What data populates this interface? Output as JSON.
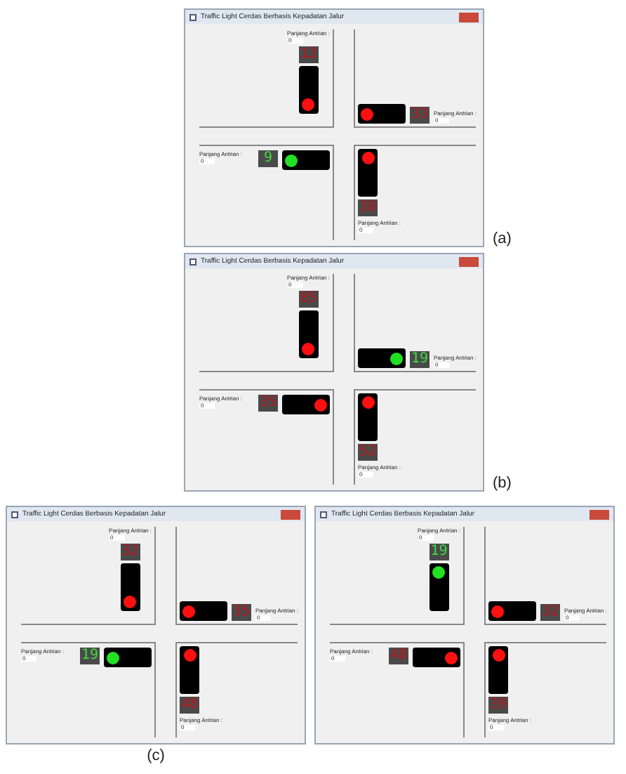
{
  "windows": [
    {
      "title": "Traffic Light Cerdas Berbasis Kepadatan Jalur",
      "caption": "(a)",
      "arms": {
        "north": {
          "label": "Panjang Antrian :",
          "queue": "0",
          "count": "12",
          "green": false
        },
        "east": {
          "label": "Panjang Antrian :",
          "queue": "0",
          "count": "33",
          "green": false
        },
        "west": {
          "label": "Panjang Antrian :",
          "queue": "0",
          "count": "9",
          "green": true
        },
        "south": {
          "label": "Panjang Antrian :",
          "queue": "0",
          "count": "30",
          "green": false
        }
      }
    },
    {
      "title": "Traffic Light Cerdas Berbasis Kepadatan Jalur",
      "caption": "(b)",
      "arms": {
        "north": {
          "label": "Panjang Antrian :",
          "queue": "0",
          "count": "85",
          "green": false
        },
        "east": {
          "label": "Panjang Antrian :",
          "queue": "0",
          "count": "19",
          "green": true
        },
        "west": {
          "label": "Panjang Antrian :",
          "queue": "0",
          "count": "35",
          "green": false
        },
        "south": {
          "label": "Panjang Antrian :",
          "queue": "0",
          "count": "52",
          "green": false
        }
      }
    },
    {
      "title": "Traffic Light Cerdas Berbasis Kepadatan Jalur",
      "caption": "(c)",
      "arms": {
        "north": {
          "label": "Panjang Antrian :",
          "queue": "0",
          "count": "32",
          "green": false
        },
        "east": {
          "label": "Panjang Antrian :",
          "queue": "0",
          "count": "35",
          "green": false
        },
        "west": {
          "label": "Panjang Antrian :",
          "queue": "0",
          "count": "19",
          "green": true
        },
        "south": {
          "label": "Panjang Antrian :",
          "queue": "0",
          "count": "48",
          "green": false
        }
      }
    },
    {
      "title": "Traffic Light Cerdas Berbasis Kepadatan Jalur",
      "arms": {
        "north": {
          "label": "Panjang Antrian :",
          "queue": "0",
          "count": "19",
          "green": true
        },
        "east": {
          "label": "Panjang Antrian :",
          "queue": "0",
          "count": "32",
          "green": false
        },
        "west": {
          "label": "Panjang Antrian :",
          "queue": "0",
          "count": "48",
          "green": false
        },
        "south": {
          "label": "Panjang Antrian :",
          "queue": "0",
          "count": "39",
          "green": false
        }
      }
    }
  ]
}
